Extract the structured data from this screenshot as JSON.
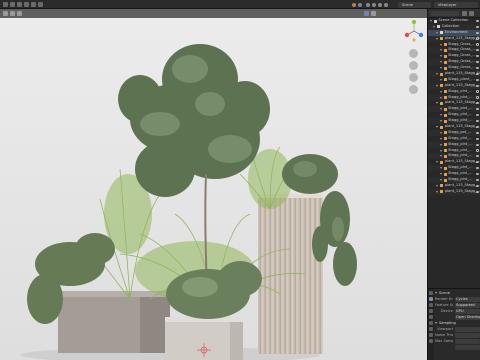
{
  "app": {
    "scene_name": "Scene",
    "view_layer": "ViewLayer",
    "viewport_mode": "",
    "shading_label": "",
    "options_label": ""
  },
  "viewport": {
    "info_lines": [
      "",
      ""
    ]
  },
  "outliner": {
    "rows": [
      {
        "label": "Scene Collection",
        "indent": 0,
        "icon": "collection-icon",
        "color": "#cfcfcf",
        "selected": false
      },
      {
        "label": "Collection",
        "indent": 1,
        "icon": "collection-icon",
        "color": "#cfcfcf",
        "selected": false
      },
      {
        "label": "Environment",
        "indent": 2,
        "icon": "collection-icon",
        "color": "#cfcfcf",
        "selected": true
      },
      {
        "label": "plant_115_Stagg_Gross_...",
        "indent": 2,
        "icon": "mesh-icon",
        "color": "#e8a04a",
        "selected": false
      },
      {
        "label": "Stagg_Gross_...",
        "indent": 3,
        "icon": "mesh-icon",
        "color": "#e8a04a",
        "selected": false
      },
      {
        "label": "Stagg_Gross_...",
        "indent": 3,
        "icon": "mesh-icon",
        "color": "#e8a04a",
        "selected": false
      },
      {
        "label": "Stagg_Gross_...",
        "indent": 3,
        "icon": "mesh-icon",
        "color": "#e8a04a",
        "selected": false
      },
      {
        "label": "Stagg_Gross_...",
        "indent": 3,
        "icon": "mesh-icon",
        "color": "#e8a04a",
        "selected": false
      },
      {
        "label": "Stagg_Gross_...",
        "indent": 3,
        "icon": "mesh-icon",
        "color": "#e8a04a",
        "selected": false
      },
      {
        "label": "plant_115_Stagg_Gross_...",
        "indent": 2,
        "icon": "mesh-icon",
        "color": "#e8a04a",
        "selected": false
      },
      {
        "label": "Stagg_plant_...",
        "indent": 3,
        "icon": "mesh-icon",
        "color": "#e8a04a",
        "selected": false
      },
      {
        "label": "plant_115_Stagg_...",
        "indent": 2,
        "icon": "mesh-icon",
        "color": "#e8a04a",
        "selected": false
      },
      {
        "label": "Stagg_plnt_...",
        "indent": 3,
        "icon": "mesh-icon",
        "color": "#e8a04a",
        "selected": false
      },
      {
        "label": "Stagg_plnt_...",
        "indent": 3,
        "icon": "mesh-icon",
        "color": "#e8a04a",
        "selected": false
      },
      {
        "label": "plant_115_Stagg_...",
        "indent": 2,
        "icon": "mesh-icon",
        "color": "#e8a04a",
        "selected": false
      },
      {
        "label": "Stagg_plnt_...",
        "indent": 3,
        "icon": "mesh-icon",
        "color": "#e8a04a",
        "selected": false
      },
      {
        "label": "Stagg_plnt_...",
        "indent": 3,
        "icon": "mesh-icon",
        "color": "#e8a04a",
        "selected": false
      },
      {
        "label": "Stagg_plnt_...",
        "indent": 3,
        "icon": "mesh-icon",
        "color": "#e8a04a",
        "selected": false
      },
      {
        "label": "plant_115_Stagg_...",
        "indent": 2,
        "icon": "mesh-icon",
        "color": "#e8a04a",
        "selected": false
      },
      {
        "label": "Stagg_pot_...",
        "indent": 3,
        "icon": "mesh-icon",
        "color": "#e8a04a",
        "selected": false
      },
      {
        "label": "Stagg_plnt_...",
        "indent": 3,
        "icon": "mesh-icon",
        "color": "#e8a04a",
        "selected": false
      },
      {
        "label": "Stagg_plnt_...",
        "indent": 3,
        "icon": "mesh-icon",
        "color": "#e8a04a",
        "selected": false
      },
      {
        "label": "Stagg_plnt_...",
        "indent": 3,
        "icon": "mesh-icon",
        "color": "#e8a04a",
        "selected": false
      },
      {
        "label": "Stagg_plnt_...",
        "indent": 3,
        "icon": "mesh-icon",
        "color": "#e8a04a",
        "selected": false
      },
      {
        "label": "plant_115_Stagg_...",
        "indent": 2,
        "icon": "mesh-icon",
        "color": "#e8a04a",
        "selected": false
      },
      {
        "label": "Stagg_plnt_...",
        "indent": 3,
        "icon": "mesh-icon",
        "color": "#e8a04a",
        "selected": false
      },
      {
        "label": "Stagg_plnt_...",
        "indent": 3,
        "icon": "mesh-icon",
        "color": "#e8a04a",
        "selected": false
      },
      {
        "label": "Stagg_plnt_...",
        "indent": 3,
        "icon": "mesh-icon",
        "color": "#e8a04a",
        "selected": false
      },
      {
        "label": "plant_115_Stagg_...",
        "indent": 2,
        "icon": "mesh-icon",
        "color": "#e8a04a",
        "selected": false
      },
      {
        "label": "plant_115_Stagg_...",
        "indent": 2,
        "icon": "mesh-icon",
        "color": "#e8a04a",
        "selected": false
      }
    ]
  },
  "properties": {
    "header": "Scene",
    "rows": [
      {
        "label": "Render Engine",
        "value": "Cycles"
      },
      {
        "label": "Feature Set",
        "value": "Supported"
      },
      {
        "label": "Device",
        "value": "GPU"
      },
      {
        "label": "",
        "value": "Open Shading Language"
      }
    ],
    "section": "Sampling",
    "rows2": [
      {
        "label": "Viewport",
        "value": ""
      },
      {
        "label": "Noise Threshold",
        "value": ""
      },
      {
        "label": "Max Samples",
        "value": ""
      },
      {
        "label": "",
        "value": ""
      }
    ]
  },
  "colors": {
    "accent": "#e8a04a",
    "selection": "#3e4b5d",
    "viewport_bg": "#e9e9e9"
  }
}
